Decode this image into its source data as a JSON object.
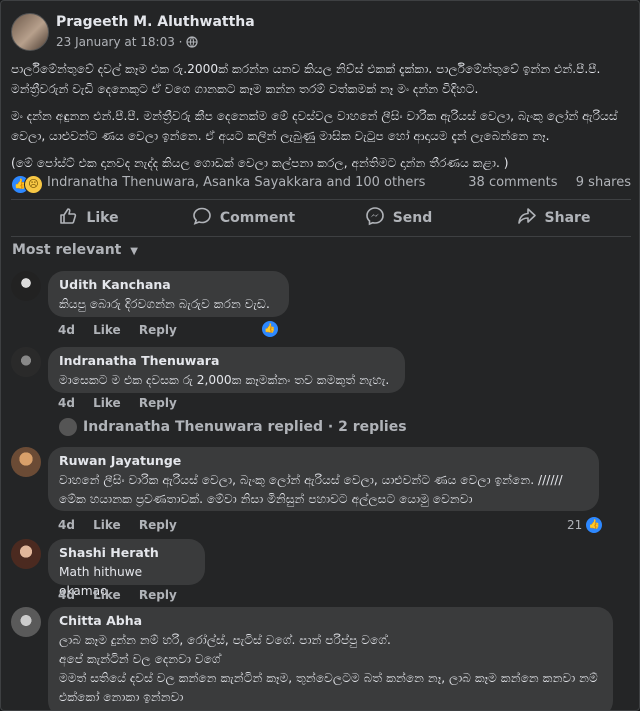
{
  "post": {
    "author": "Prageeth M. Aluthwattha",
    "date": "23 January at 18:03 · ",
    "paragraphs": [
      "පාර්ලිමේන්තුවේ දවල් කෑම එක රු.2000ක් කරන්න යනව කියල නිව්ස් එකක් දැක්කා. පාර්ලිමේන්තුවේ ඉන්න එන්.පී.පී. මන්ත්‍රීවරුන් වැඩි දෙනෙකුට ඒ වගෙ ගානකට කෑම කන්න තරම් වත්කමක් නෑ මං දන්න විදිහට.",
      "මං දන්න අඳුනන එන්.පී.පී. මන්ත්‍රීවරු කීප දෙනෙක්ම මේ දවස්වල වාහනේ ලීසිං වාරික ඇරියස් වෙලා, බැංකු ලෝන් ඇරියස් වෙලා, යාළුවන්ට ණය වෙලා ඉන්නෙ. ඒ අයට කලින් ලැබුණු මාසික වැටුප හෝ ආදායම දැන් ලැබෙන්නෙ නෑ.",
      "(මේ පෝස්ට් එක දානවද නැද්ද කියල ගොඩක් වෙලා කල්පනා කරල, අන්තිමට දාන්න තීරණය කළා. )"
    ],
    "reactions_text": "Indranatha Thenuwara, Asanka Sayakkara and 100 others",
    "comments_count": "38 comments",
    "shares_count": "9 shares"
  },
  "actions": {
    "like": "Like",
    "comment": "Comment",
    "send": "Send",
    "share": "Share"
  },
  "sort_label": "Most relevant",
  "comments": [
    {
      "name": "Udith Kanchana",
      "text": "කියපු බොරු දිරවගන්න බැරුව කරන වැඩ.",
      "age": "4d",
      "like": "Like",
      "reply": "Reply",
      "react_count": ""
    },
    {
      "name": "Indranatha Thenuwara",
      "text": "මාසෙකට ම එක දවසක රු 2,000ක කෑමක්නං තව කමකුත් නැහැ.",
      "age": "4d",
      "like": "Like",
      "reply": "Reply"
    },
    {
      "name": "Ruwan Jayatunge",
      "text": "වාහනේ ලීසිං වාරික ඇරියස් වෙලා, බැංකු ලෝන් ඇරියස් වෙලා, යාළුවන්ට ණය වෙලා ඉන්නෙ. ////// මේක හයානක ප්‍රවණතාවක්. මේවා නිසා මිනිසුන් පහාවට අල්ලසට යොමු වෙනවා",
      "age": "4d",
      "like": "Like",
      "reply": "Reply",
      "react_count": "21"
    },
    {
      "name": "Shashi Herath",
      "text": "Math hithuwe okamao",
      "age": "4d",
      "like": "Like",
      "reply": "Reply"
    },
    {
      "name": "Chitta Abha",
      "text": "ලාබ කෑම දුන්න නම් හරි, රෝල්ස්, පැටිස් වගේ. පාන් පරිප්පු වගේ.\nඅපේ කැන්ටින් වල දෙනවා වගේ\nමමත් සතියේ දවස් වල කන්නෙ කැන්ටින් කෑම, තුන්වෙලටම බත් කන්නෙ නෑ, ලාබ කෑම කන්නෙ කනවා නම් එක්කෝ නොකා ඉන්නවා"
    }
  ],
  "replies_line": "Indranatha Thenuwara replied · 2 replies"
}
